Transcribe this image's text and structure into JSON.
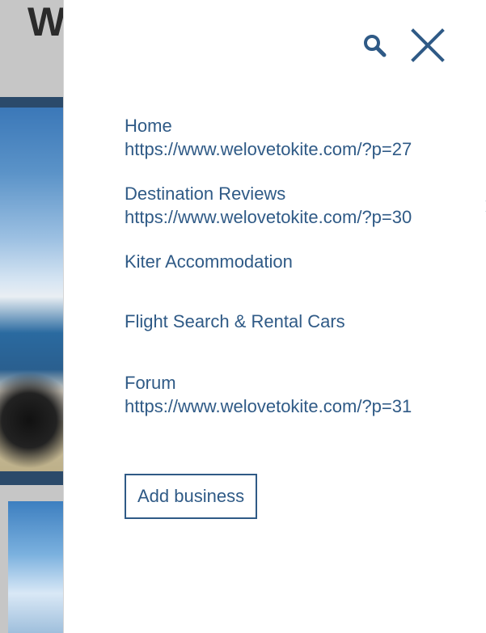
{
  "background": {
    "logo_text": "W"
  },
  "menu": {
    "items": [
      {
        "title": "Home",
        "url": "https://www.welovetokite.com/?p=27",
        "has_submenu": false
      },
      {
        "title": "Destination Reviews",
        "url": "https://www.welovetokite.com/?p=30",
        "has_submenu": true
      },
      {
        "title": "Kiter Accommodation",
        "url": "",
        "has_submenu": false
      },
      {
        "title": "Flight Search & Rental Cars",
        "url": "",
        "has_submenu": false
      },
      {
        "title": "Forum",
        "url": "https://www.welovetokite.com/?p=31",
        "has_submenu": false
      }
    ],
    "add_business_label": "Add business"
  },
  "icons": {
    "search": "search-icon",
    "close": "close-icon",
    "chevron": "chevron-right-icon"
  },
  "colors": {
    "accent": "#2f5a86",
    "background_band": "#2b4a6a"
  }
}
